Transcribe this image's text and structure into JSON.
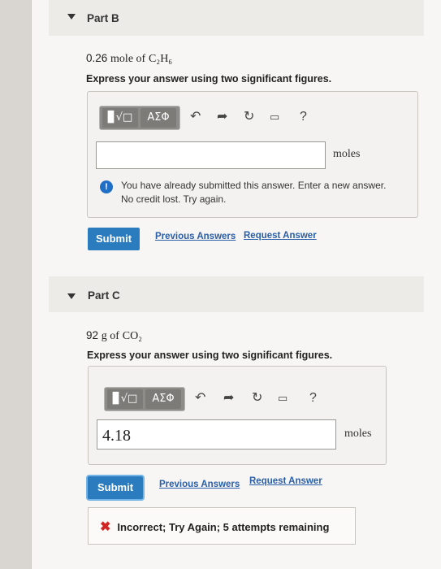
{
  "part_b": {
    "title": "Part B",
    "question_num": "0.26",
    "question_text": "mole of",
    "formula": "C₂H₆",
    "instruction": "Express your answer using two significant figures.",
    "toolbar": {
      "template_label": "▊√□",
      "greek_label": "ΑΣΦ",
      "help_label": "?"
    },
    "input_value": "",
    "units": "moles",
    "warning_line1": "You have already submitted this answer. Enter a new answer.",
    "warning_line2": "No credit lost. Try again.",
    "submit_label": "Submit",
    "previous_answers_label": "Previous Answers",
    "request_answer_label": "Request Answer"
  },
  "part_c": {
    "title": "Part C",
    "question_num": "92",
    "question_text": "g of",
    "formula": "CO₂",
    "instruction": "Express your answer using two significant figures.",
    "toolbar": {
      "template_label": "▊√□",
      "greek_label": "ΑΣΦ",
      "help_label": "?"
    },
    "input_value": "4.18",
    "units": "moles",
    "submit_label": "Submit",
    "previous_answers_label": "Previous Answers",
    "request_answer_label": "Request Answer",
    "feedback_text": "Incorrect; Try Again; 5 attempts remaining"
  }
}
